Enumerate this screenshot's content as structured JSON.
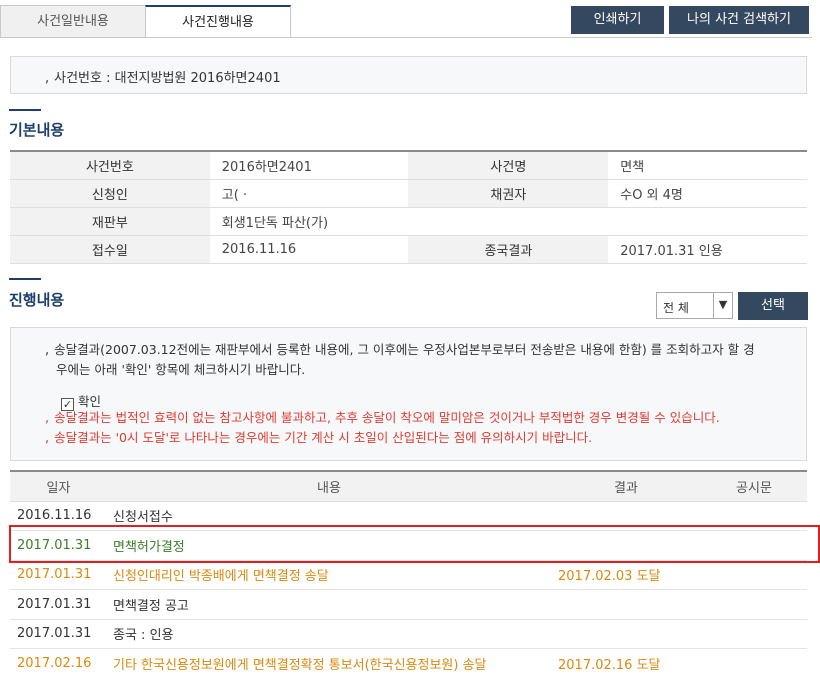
{
  "tabs": [
    {
      "label": "사건일반내용"
    },
    {
      "label": "사건진행내용"
    }
  ],
  "buttons": {
    "print": "인쇄하기",
    "my_search": "나의 사건 검색하기",
    "select": "선택"
  },
  "case_number_line": "사건번호 : 대전지방법원 2016하면2401",
  "basic": {
    "title": "기본내용",
    "rows": [
      {
        "h1": "사건번호",
        "v1": "2016하면2401",
        "h2": "사건명",
        "v2": "면책"
      },
      {
        "h1": "신청인",
        "v1": "고(  ·",
        "h2": "채권자",
        "v2": "수O 외 4명"
      },
      {
        "h1": "재판부",
        "v1": "회생1단독 파산(가)",
        "h2": "",
        "v2": ""
      },
      {
        "h1": "접수일",
        "v1": "2016.11.16",
        "h2": "종국결과",
        "v2": "2017.01.31 인용"
      }
    ]
  },
  "progress": {
    "title": "진행내용",
    "filter_value": "전 체",
    "notice": {
      "line1": "송달결과(2007.03.12전에는 재판부에서 등록한 내용에, 그 이후에는 우정사업본부로부터 전송받은 내용에 한함) 를 조회하고자 할 경",
      "line2": "우에는 아래 '확인' 항목에 체크하시기 바랍니다.",
      "check_label": "확인",
      "warn1": "송달결과는 법적인 효력이 없는 참고사항에 불과하고, 추후 송달이 착오에 말미암은 것이거나 부적법한 경우 변경될 수 있습니다.",
      "warn2": "송달결과는 '0시 도달'로 나타나는 경우에는 기간 계산 시 초일이 산입된다는 점에 유의하시기 바랍니다."
    },
    "columns": [
      "일자",
      "내용",
      "결과",
      "공시문"
    ],
    "rows": [
      {
        "date": "2016.11.16",
        "content": "신청서접수",
        "result": "",
        "notice": "",
        "color": "normal"
      },
      {
        "date": "2017.01.31",
        "content": "면책허가결정",
        "result": "",
        "notice": "",
        "color": "green"
      },
      {
        "date": "2017.01.31",
        "content": "신청인대리인 박종배에게 면책결정 송달",
        "result": "2017.02.03 도달",
        "notice": "",
        "color": "orange"
      },
      {
        "date": "2017.01.31",
        "content": "면책결정 공고",
        "result": "",
        "notice": "",
        "color": "normal"
      },
      {
        "date": "2017.01.31",
        "content": "종국 : 인용",
        "result": "",
        "notice": "",
        "color": "normal"
      },
      {
        "date": "2017.02.16",
        "content": "기타 한국신용정보원에게 면책결정확정 통보서(한국신용정보원) 송달",
        "result": "2017.02.16 도달",
        "notice": "",
        "color": "orange"
      }
    ]
  },
  "colors": {
    "navy": "#34495f",
    "green": "#3a7d2a",
    "orange": "#d98a10",
    "red": "#e03c31",
    "highlight": "#e02020"
  }
}
